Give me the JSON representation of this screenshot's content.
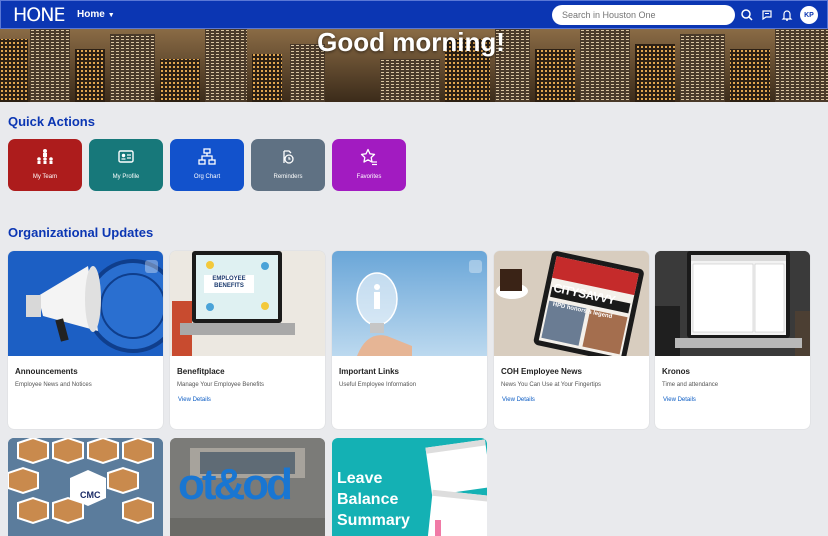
{
  "header": {
    "logo": "HONE",
    "nav_home": "Home",
    "search_placeholder": "Search in Houston One",
    "avatar_initials": "KP"
  },
  "hero": {
    "greeting": "Good morning!"
  },
  "quick_actions": {
    "title": "Quick Actions",
    "items": [
      {
        "label": "My Team",
        "icon": "team-icon",
        "color": "#ad1c1c"
      },
      {
        "label": "My Profile",
        "icon": "profile-icon",
        "color": "#17787a"
      },
      {
        "label": "Org Chart",
        "icon": "org-chart-icon",
        "color": "#1252cc"
      },
      {
        "label": "Reminders",
        "icon": "reminder-icon",
        "color": "#5f7183"
      },
      {
        "label": "Favorites",
        "icon": "favorites-icon",
        "color": "#a21bc1"
      }
    ]
  },
  "org_updates": {
    "title": "Organizational Updates",
    "cards": [
      {
        "title": "Announcements",
        "subtitle": "Employee News and Notices",
        "link": ""
      },
      {
        "title": "Benefitplace",
        "subtitle": "Manage Your Employee Benefits",
        "link": "View Details",
        "image_text": "EMPLOYEE BENEFITS"
      },
      {
        "title": "Important Links",
        "subtitle": "Useful Employee Information",
        "link": ""
      },
      {
        "title": "COH Employee News",
        "subtitle": "News You Can Use at Your Fingertips",
        "link": "View Details",
        "image_text": "CITYSAVVY",
        "image_subtext": "HPD honors a legend"
      },
      {
        "title": "Kronos",
        "subtitle": "Time and attendance",
        "link": "View Details"
      }
    ],
    "row2": [
      {
        "image_text": "CMC"
      },
      {
        "image_text": "ot&od"
      },
      {
        "image_text": "Leave Balance Summary"
      }
    ]
  },
  "colors": {
    "brand": "#0b36b3",
    "link": "#0b5cc4",
    "background": "#e9eaed"
  }
}
